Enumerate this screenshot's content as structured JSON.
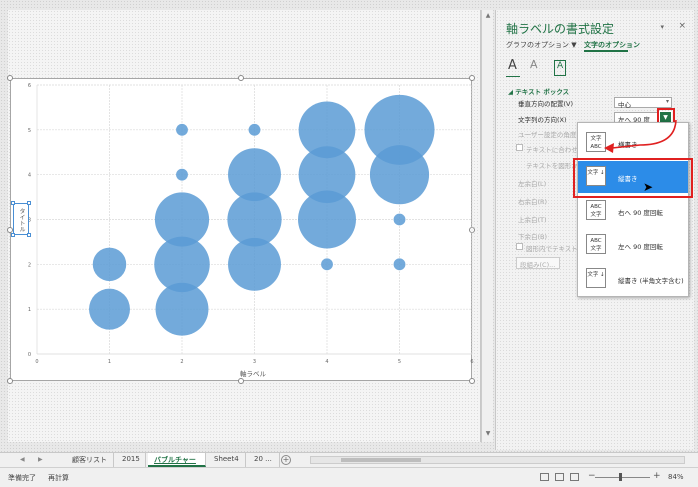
{
  "panel": {
    "title": "軸ラベルの書式設定",
    "tab_graph": "グラフのオプション ▼",
    "tab_text": "文字のオプション",
    "close": "×",
    "pin": "▾",
    "icon_text_fill": "A",
    "icon_text_effect": "A",
    "icon_textbox": "A",
    "section": "◢ テキスト ボックス",
    "rows": {
      "vertical_align_label": "垂直方向の配置(V)",
      "vertical_align_value": "中心",
      "text_direction_label": "文字列の方向(X)",
      "text_direction_value": "左へ 90 度",
      "custom_angle_label": "ユーザー設定の角度",
      "autofit_label": "テキストに合わせて",
      "resize_label": "テキストを図形から",
      "left_margin_label": "左余白(L)",
      "right_margin_label": "右余白(R)",
      "top_margin_label": "上余白(T)",
      "bottom_margin_label": "下余白(B)",
      "wrap_label": "図形内でテキストを",
      "columns_button": "段組み(C)..."
    }
  },
  "menu": {
    "items": [
      {
        "icon": "文字 ABC",
        "label": "横書き"
      },
      {
        "icon": "文字 ↓",
        "label": "縦書き"
      },
      {
        "icon": "ABC 文字",
        "label": "右へ 90 度回転"
      },
      {
        "icon": "ABC 文字",
        "label": "左へ 90 度回転"
      },
      {
        "icon": "文字 ↓",
        "label": "縦書き (半角文字含む)"
      }
    ]
  },
  "chart": {
    "y_axis_title": "タイトル",
    "x_axis_title": "軸ラベル"
  },
  "chart_data": {
    "type": "scatter",
    "title": "",
    "xlabel": "軸ラベル",
    "ylabel": "タイトル",
    "xlim": [
      0,
      6
    ],
    "ylim": [
      0,
      6
    ],
    "xticks": [
      "0",
      "1",
      "2",
      "3",
      "4",
      "5",
      "6"
    ],
    "yticks": [
      "0",
      "1",
      "2",
      "3",
      "4",
      "5",
      "6"
    ],
    "bubbles": [
      {
        "x": 1,
        "y": 1,
        "size": 12
      },
      {
        "x": 1,
        "y": 2,
        "size": 8
      },
      {
        "x": 2,
        "y": 1,
        "size": 20
      },
      {
        "x": 2,
        "y": 2,
        "size": 22
      },
      {
        "x": 2,
        "y": 3,
        "size": 21
      },
      {
        "x": 2,
        "y": 4,
        "size": 1
      },
      {
        "x": 2,
        "y": 5,
        "size": 1
      },
      {
        "x": 3,
        "y": 2,
        "size": 20
      },
      {
        "x": 3,
        "y": 3,
        "size": 21
      },
      {
        "x": 3,
        "y": 4,
        "size": 20
      },
      {
        "x": 3,
        "y": 5,
        "size": 1
      },
      {
        "x": 4,
        "y": 2,
        "size": 1
      },
      {
        "x": 4,
        "y": 3,
        "size": 24
      },
      {
        "x": 4,
        "y": 4,
        "size": 23
      },
      {
        "x": 4,
        "y": 5,
        "size": 23
      },
      {
        "x": 5,
        "y": 2,
        "size": 1
      },
      {
        "x": 5,
        "y": 3,
        "size": 1
      },
      {
        "x": 5,
        "y": 4,
        "size": 25
      },
      {
        "x": 5,
        "y": 5,
        "size": 35
      }
    ],
    "grid": true,
    "bubble_color": "#5b9bd5"
  },
  "tabs": {
    "items": [
      "顧客リスト",
      "2015",
      "バブルチャート",
      "Sheet4",
      "20 ..."
    ],
    "active": "バブルチャート",
    "add": "+"
  },
  "status": {
    "ready": "準備完了",
    "recalc": "再計算",
    "zoom": "84%",
    "zoom_minus": "−",
    "zoom_plus": "+"
  },
  "colors": {
    "accent": "#217346",
    "selection": "#2c8ce8",
    "highlight": "#e02020"
  }
}
